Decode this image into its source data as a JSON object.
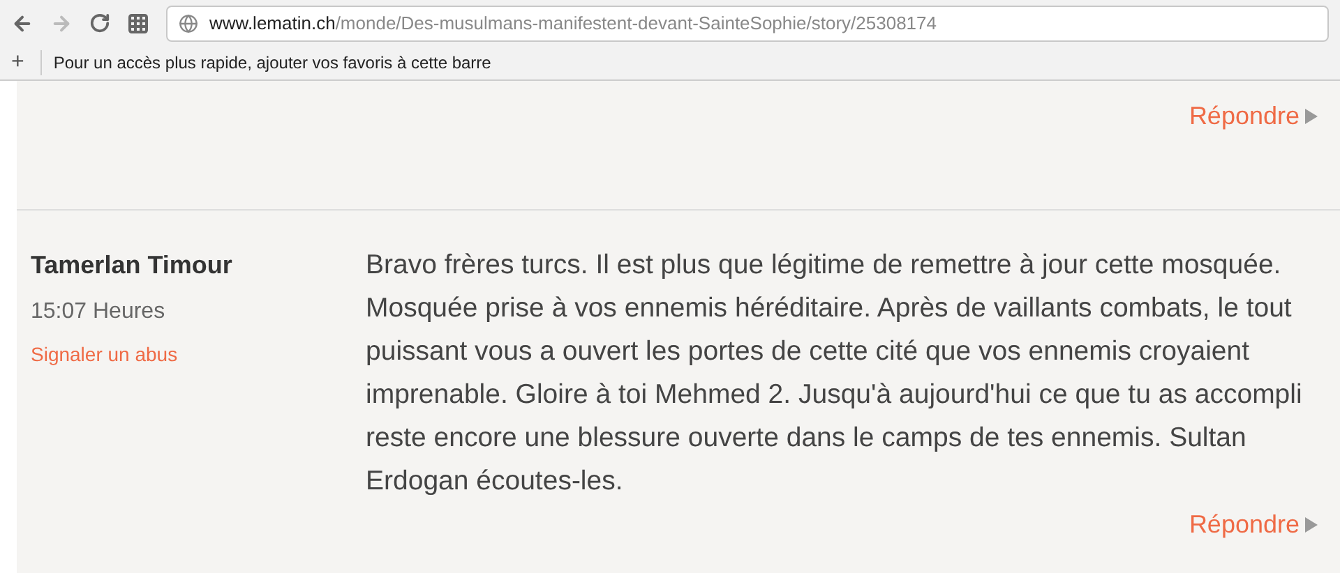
{
  "browser": {
    "url_domain": "www.lematin.ch",
    "url_path": "/monde/Des-musulmans-manifestent-devant-SainteSophie/story/25308174"
  },
  "bookmarks_bar": {
    "add": "+",
    "hint": "Pour un accès plus rapide, ajouter vos favoris à cette barre"
  },
  "comments": [
    {
      "reply": "Répondre"
    },
    {
      "author": "Tamerlan Timour",
      "time": "15:07 Heures",
      "report": "Signaler un abus",
      "text": "Bravo frères turcs. Il est plus que légitime de remettre à jour cette mosquée. Mosquée prise à vos ennemis héréditaire. Après de vaillants combats, le tout puissant vous a ouvert les portes de cette cité que vos ennemis croyaient imprenable. Gloire à toi Mehmed 2. Jusqu'à aujourd'hui ce que tu as accompli reste encore une blessure ouverte dans le camps de tes ennemis. Sultan Erdogan écoutes-les.",
      "reply": "Répondre"
    }
  ]
}
